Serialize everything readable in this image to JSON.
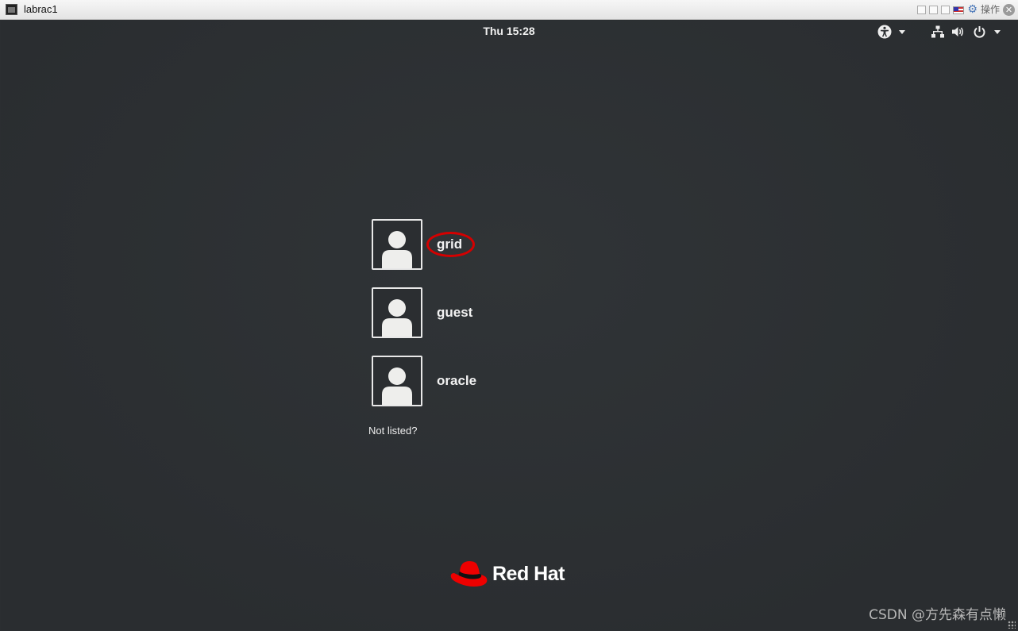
{
  "vm_window": {
    "title": "labrac1",
    "action_label": "操作",
    "close_glyph": "✕",
    "icons": [
      "terminal-icon",
      "restore-icon",
      "minimize-icon",
      "maximize-icon",
      "keyboard-flag-icon",
      "gear-icon",
      "close-icon"
    ]
  },
  "topbar": {
    "clock": "Thu 15:28",
    "icons": [
      "accessibility-icon",
      "network-icon",
      "volume-icon",
      "power-icon"
    ]
  },
  "login": {
    "users": [
      {
        "name": "grid",
        "highlighted": true
      },
      {
        "name": "guest",
        "highlighted": false
      },
      {
        "name": "oracle",
        "highlighted": false
      }
    ],
    "not_listed": "Not listed?"
  },
  "brand": {
    "name": "Red Hat",
    "hat_color": "#ee0000"
  },
  "watermark": "CSDN @方先森有点懒",
  "colors": {
    "highlight": "#d40000",
    "background": "#2d3033"
  }
}
